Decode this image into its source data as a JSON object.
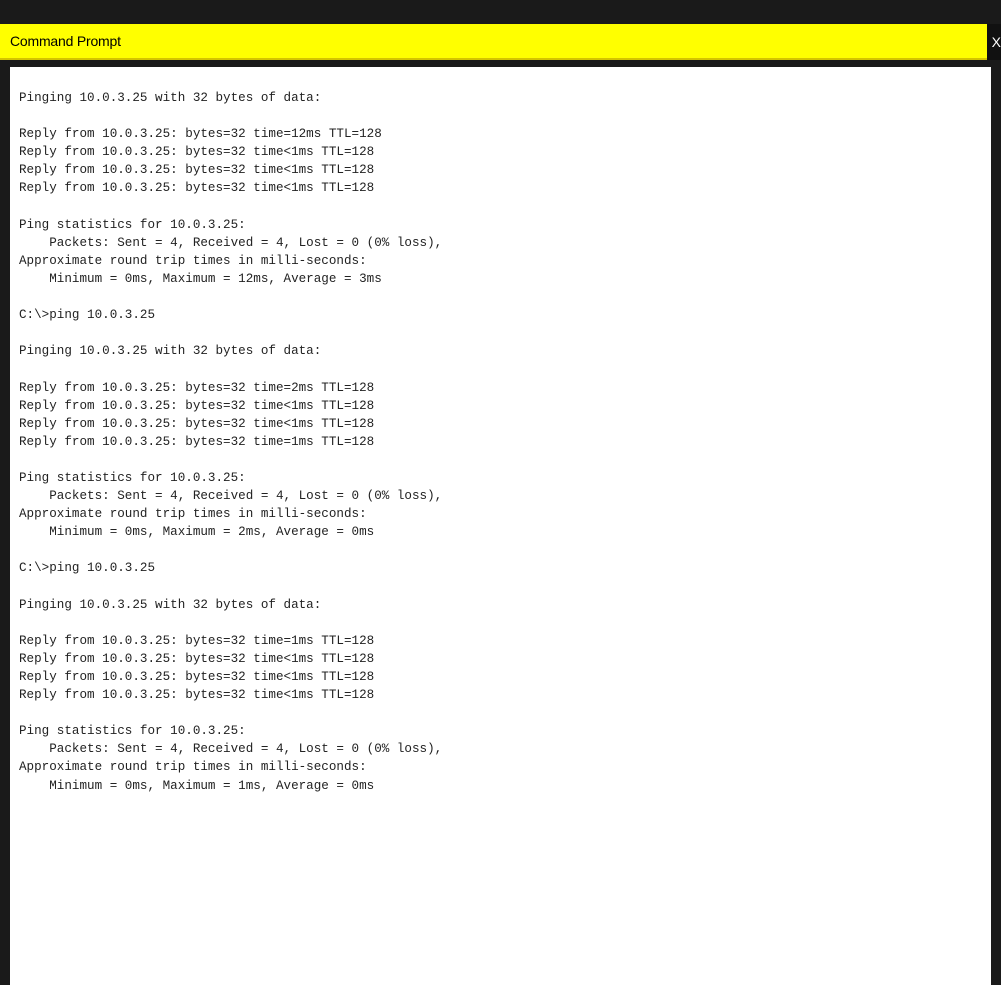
{
  "window": {
    "title": "Command Prompt",
    "close_label": "X"
  },
  "console": {
    "lines": [
      "Pinging 10.0.3.25 with 32 bytes of data:",
      "",
      "Reply from 10.0.3.25: bytes=32 time=12ms TTL=128",
      "Reply from 10.0.3.25: bytes=32 time<1ms TTL=128",
      "Reply from 10.0.3.25: bytes=32 time<1ms TTL=128",
      "Reply from 10.0.3.25: bytes=32 time<1ms TTL=128",
      "",
      "Ping statistics for 10.0.3.25:",
      "    Packets: Sent = 4, Received = 4, Lost = 0 (0% loss),",
      "Approximate round trip times in milli-seconds:",
      "    Minimum = 0ms, Maximum = 12ms, Average = 3ms",
      "",
      "C:\\>ping 10.0.3.25",
      "",
      "Pinging 10.0.3.25 with 32 bytes of data:",
      "",
      "Reply from 10.0.3.25: bytes=32 time=2ms TTL=128",
      "Reply from 10.0.3.25: bytes=32 time<1ms TTL=128",
      "Reply from 10.0.3.25: bytes=32 time<1ms TTL=128",
      "Reply from 10.0.3.25: bytes=32 time=1ms TTL=128",
      "",
      "Ping statistics for 10.0.3.25:",
      "    Packets: Sent = 4, Received = 4, Lost = 0 (0% loss),",
      "Approximate round trip times in milli-seconds:",
      "    Minimum = 0ms, Maximum = 2ms, Average = 0ms",
      "",
      "C:\\>ping 10.0.3.25",
      "",
      "Pinging 10.0.3.25 with 32 bytes of data:",
      "",
      "Reply from 10.0.3.25: bytes=32 time=1ms TTL=128",
      "Reply from 10.0.3.25: bytes=32 time<1ms TTL=128",
      "Reply from 10.0.3.25: bytes=32 time<1ms TTL=128",
      "Reply from 10.0.3.25: bytes=32 time<1ms TTL=128",
      "",
      "Ping statistics for 10.0.3.25:",
      "    Packets: Sent = 4, Received = 4, Lost = 0 (0% loss),",
      "Approximate round trip times in milli-seconds:",
      "    Minimum = 0ms, Maximum = 1ms, Average = 0ms"
    ]
  },
  "colors": {
    "titlebar": "#ffff00",
    "frame": "#1a1a1a",
    "console_bg": "#ffffff",
    "console_text": "#222222"
  }
}
